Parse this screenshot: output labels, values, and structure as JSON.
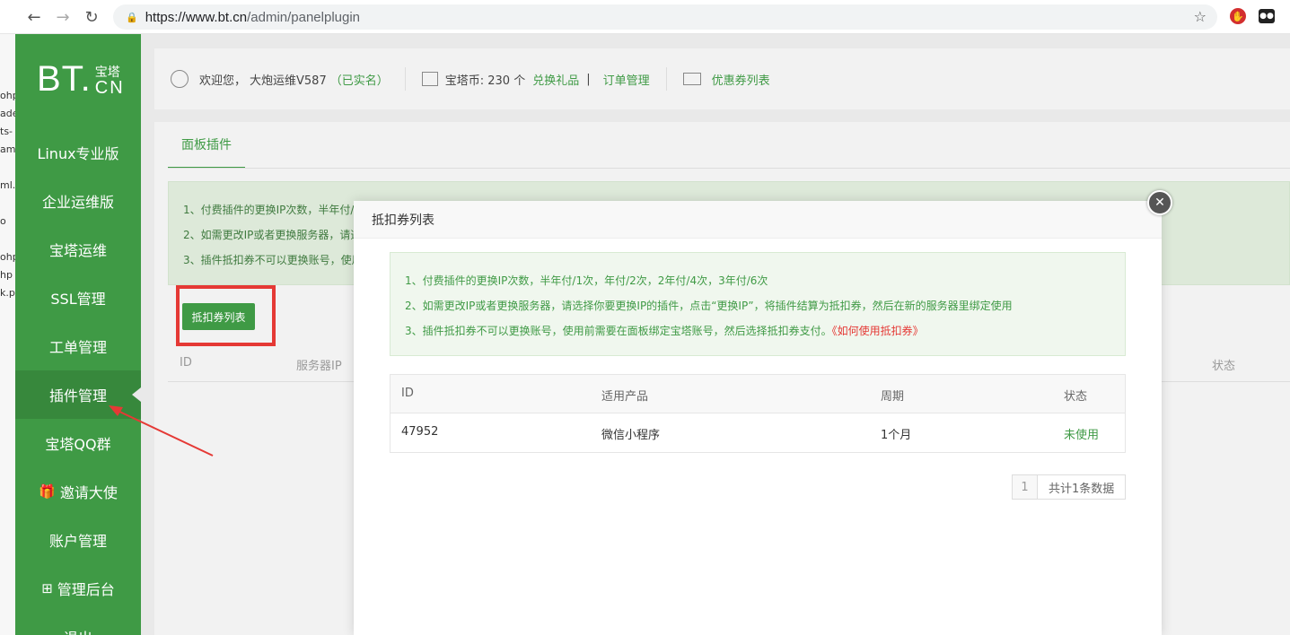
{
  "browser": {
    "url_host": "https://www.bt.cn",
    "url_path": "/admin/panelplugin",
    "back_icon": "arrow-left-icon",
    "forward_icon": "arrow-right-icon",
    "reload_icon": "reload-icon"
  },
  "left_strip": [
    "ohp",
    "ade",
    "ts-",
    "amp",
    "ml.p",
    "o",
    "ohp",
    "hp",
    "k.pl"
  ],
  "logo": {
    "bt": "BT.",
    "cn_top": "宝塔",
    "cn_bottom": "CN"
  },
  "sidebar": {
    "items": [
      {
        "label": "Linux专业版"
      },
      {
        "label": "企业运维版"
      },
      {
        "label": "宝塔运维"
      },
      {
        "label": "SSL管理"
      },
      {
        "label": "工单管理"
      },
      {
        "label": "插件管理",
        "active": true
      },
      {
        "label": "宝塔QQ群"
      },
      {
        "label": "邀请大使",
        "icon": "🎁"
      },
      {
        "label": "账户管理"
      },
      {
        "label": "管理后台",
        "icon": "⊞"
      },
      {
        "label": "退出"
      }
    ]
  },
  "header": {
    "welcome": "欢迎您，",
    "username": "大炮运维V587",
    "verified": "（已实名）",
    "coins_label": "宝塔币: 230 个",
    "exchange": "兑换礼品",
    "divider": "|",
    "orders": "订单管理",
    "coupons": "优惠券列表"
  },
  "page": {
    "tab": "面板插件",
    "notices": [
      "1、付费插件的更换IP次数，半年付/",
      "2、如需更改IP或者更换服务器，请选",
      "3、插件抵扣券不可以更换账号，使用"
    ],
    "button": "抵扣券列表",
    "table_headers": {
      "id": "ID",
      "ip": "服务器IP",
      "status": "状态"
    }
  },
  "modal": {
    "title": "抵扣券列表",
    "close_icon": "close-icon",
    "notices": [
      "1、付费插件的更换IP次数，半年付/1次，年付/2次，2年付/4次，3年付/6次",
      "2、如需更改IP或者更换服务器，请选择你要更换IP的插件，点击“更换IP”，将插件结算为抵扣券，然后在新的服务器里绑定使用",
      "3、插件抵扣券不可以更换账号，使用前需要在面板绑定宝塔账号，然后选择抵扣券支付。"
    ],
    "help_link": "《如何使用抵扣券》",
    "table": {
      "headers": [
        "ID",
        "适用产品",
        "周期",
        "状态"
      ],
      "rows": [
        {
          "id": "47952",
          "product": "微信小程序",
          "period": "1个月",
          "status": "未使用"
        }
      ]
    },
    "pagination": {
      "page": "1",
      "total": "共计1条数据"
    }
  },
  "colors": {
    "brand": "#3f9a45",
    "highlight": "#e53935"
  }
}
